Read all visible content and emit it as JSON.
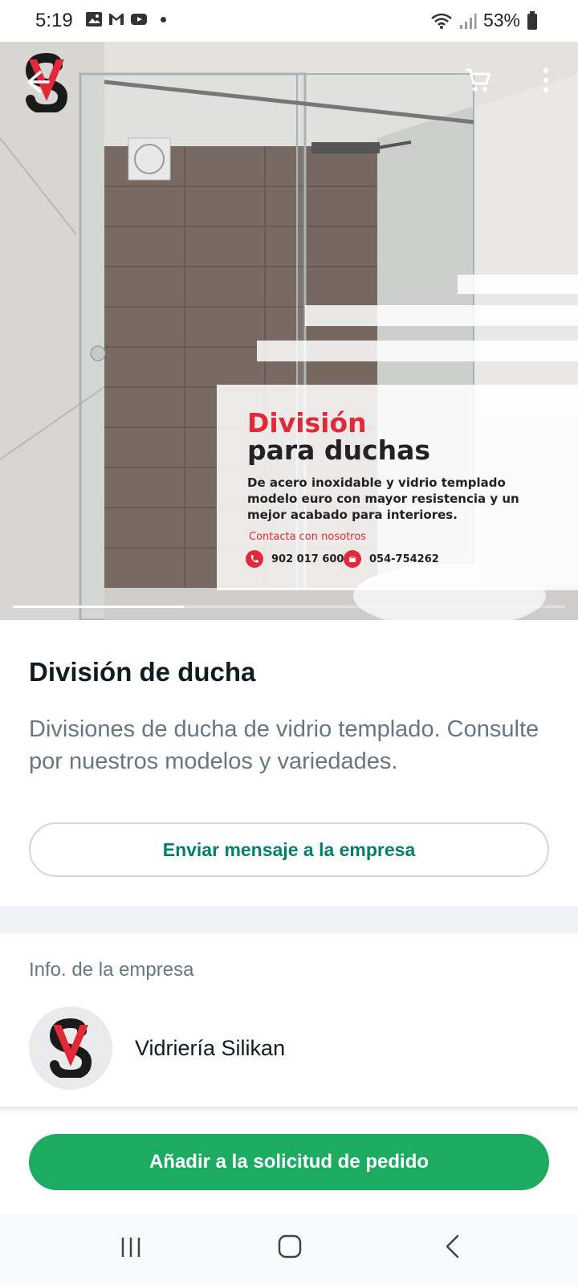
{
  "status_bar": {
    "time": "5:19",
    "battery": "53%",
    "left_icons": [
      "gallery-icon",
      "gmail-icon",
      "youtube-icon"
    ],
    "right_icons": [
      "wifi-icon",
      "signal-icon",
      "battery-icon"
    ]
  },
  "hero": {
    "promo_title_line1": "División",
    "promo_title_line2": "para duchas",
    "promo_description": "De acero inoxidable y vidrio templado modelo euro con mayor resistencia y un mejor acabado para interiores.",
    "promo_contact": "Contacta con nosotros",
    "phone_1": "902 017 600",
    "phone_2": "054-754262",
    "carousel_progress": 0.31,
    "accent_color": "#e02a3a"
  },
  "product": {
    "title": "División de ducha",
    "description": "Divisiones de ducha de vidrio templado. Consulte por nuestros modelos y variedades.",
    "message_button": "Enviar mensaje a la empresa"
  },
  "company": {
    "section_label": "Info. de la empresa",
    "name": "Vidriería Silikan"
  },
  "actions": {
    "order_button": "Añadir a la solicitud de pedido"
  },
  "colors": {
    "brand_green": "#1daa61",
    "link_green": "#008069",
    "muted_text": "#667781"
  }
}
